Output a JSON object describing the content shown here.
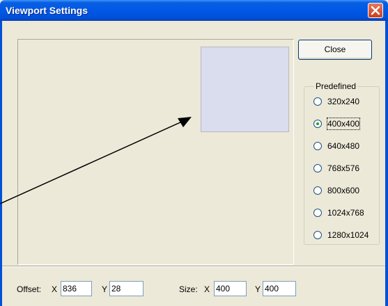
{
  "window": {
    "title": "Viewport Settings"
  },
  "buttons": {
    "close_label": "Close"
  },
  "predefined": {
    "label": "Predefined",
    "selected": "400x400",
    "options": [
      "320x240",
      "400x400",
      "640x480",
      "768x576",
      "800x600",
      "1024x768",
      "1280x1024"
    ]
  },
  "offset": {
    "label": "Offset:",
    "x_label": "X",
    "y_label": "Y",
    "x_value": "836",
    "y_value": "28"
  },
  "size": {
    "label": "Size:",
    "x_label": "X",
    "y_label": "Y",
    "x_value": "400",
    "y_value": "400"
  },
  "colors": {
    "titlebar": "#0058e6",
    "viewport_fill": "#dadded",
    "window_bg": "#ece9d8"
  }
}
